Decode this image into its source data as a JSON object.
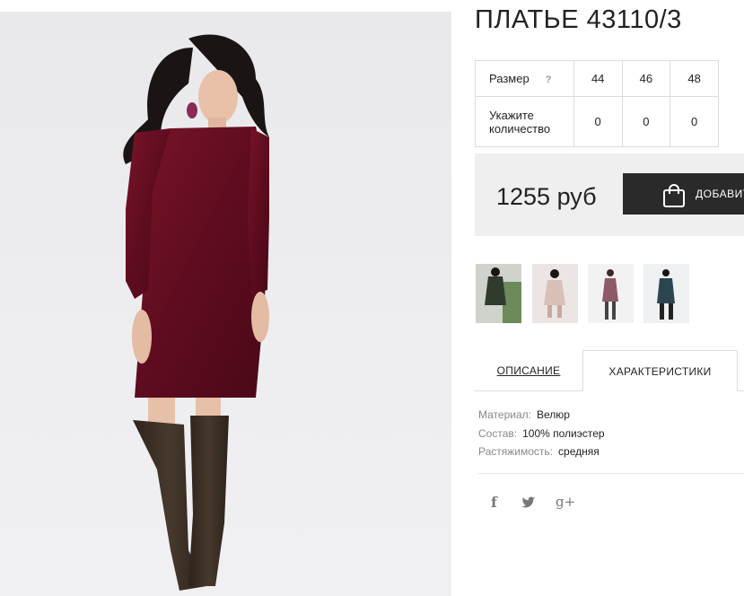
{
  "product": {
    "title": "ПЛАТЬЕ 43110/3",
    "price": "1255 руб",
    "add_to_cart_label": "ДОБАВИТЬ В КОРЗИНУ"
  },
  "size_table": {
    "size_label": "Размер",
    "help_icon": "question-mark-icon",
    "help_glyph": "?",
    "qty_label_line1": "Укажите",
    "qty_label_line2": "количество",
    "sizes": [
      "44",
      "46",
      "48"
    ],
    "quantities": [
      "0",
      "0",
      "0"
    ]
  },
  "thumbnails": [
    {
      "name": "dress-green",
      "color": "#2f3b2c"
    },
    {
      "name": "dress-beige",
      "color": "#d8c0b6"
    },
    {
      "name": "dress-mauve",
      "color": "#8d5a67"
    },
    {
      "name": "dress-teal",
      "color": "#2c4650"
    }
  ],
  "tabs": {
    "description": "ОПИСАНИЕ",
    "characteristics": "ХАРАКТЕРИСТИКИ",
    "active": "characteristics"
  },
  "characteristics": [
    {
      "key": "Материал:",
      "value": "Велюр"
    },
    {
      "key": "Состав:",
      "value": "100% полиэстер"
    },
    {
      "key": "Растяжимость:",
      "value": "средняя"
    }
  ],
  "social": [
    {
      "name": "facebook-icon",
      "glyph": "f"
    },
    {
      "name": "twitter-icon",
      "glyph": "🐦"
    },
    {
      "name": "google-plus-icon",
      "glyph": "g+"
    }
  ],
  "colors": {
    "dress": "#6e0f24",
    "boots": "#3b2f26",
    "button": "#2a2a2a",
    "price_bg": "#efefef"
  }
}
